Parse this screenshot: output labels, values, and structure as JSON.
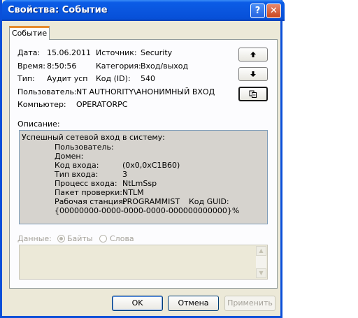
{
  "window": {
    "title": "Свойства: Событие",
    "help_label": "?",
    "close_label": "✕"
  },
  "tab": {
    "label": "Событие"
  },
  "fields": {
    "date_label": "Дата:",
    "date_value": "15.06.2011",
    "time_label": "Время:",
    "time_value": "8:50:56",
    "type_label": "Тип:",
    "type_value": "Аудит усп",
    "source_label": "Источник:",
    "source_value": "Security",
    "category_label": "Категория:",
    "category_value": "Вход/выход",
    "id_label": "Код (ID):",
    "id_value": "540",
    "user_label": "Пользователь:",
    "user_value": "NT AUTHORITY\\АНОНИМНЫЙ ВХОД",
    "computer_label": "Компьютер:",
    "computer_value": "OPERATORPC"
  },
  "nav": {
    "up_icon": "arrow-up-icon",
    "down_icon": "arrow-down-icon",
    "copy_icon": "copy-icon",
    "up_glyph": "🡅",
    "down_glyph": "🡇"
  },
  "description": {
    "label": "Описание:",
    "header": "Успешный сетевой вход в систему:",
    "rows": [
      {
        "key": "Пользователь:",
        "value": ""
      },
      {
        "key": "Домен:",
        "value": ""
      },
      {
        "key": "Код входа:",
        "value": "(0x0,0xC1B60)"
      },
      {
        "key": "Тип входа:",
        "value": "3"
      },
      {
        "key": "Процесс входа:",
        "value": "NtLmSsp"
      },
      {
        "key": "Пакет проверки:",
        "value": "NTLM"
      },
      {
        "key": "Рабочая станция:",
        "value": "PROGRAMMIST"
      }
    ],
    "guid_label": "Код GUID:",
    "guid_value": "{00000000-0000-0000-0000-000000000000}%"
  },
  "data": {
    "label": "Данные:",
    "bytes_label": "Байты",
    "words_label": "Слова",
    "selected": "Байты"
  },
  "buttons": {
    "ok": "OK",
    "cancel": "Отмена",
    "apply": "Применить"
  }
}
